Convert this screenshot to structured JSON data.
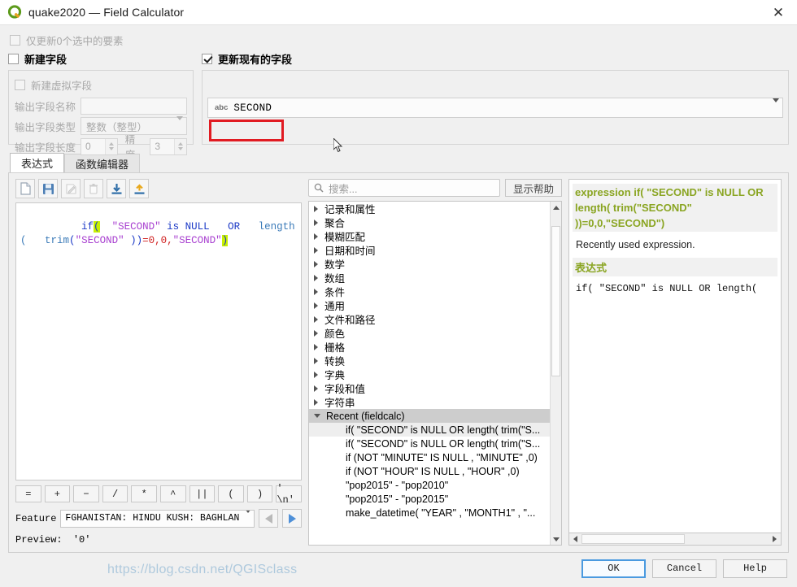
{
  "window": {
    "title": "quake2020 — Field Calculator",
    "logo_icon": "qgis-q-logo-icon",
    "close_icon": "✕"
  },
  "options": {
    "only_selected_label": "仅更新0个选中的要素",
    "create_new_field_label": "新建字段",
    "update_existing_field_label": "更新现有的字段"
  },
  "new_field": {
    "virtual_field_label": "新建虚拟字段",
    "name_label": "输出字段名称",
    "name_value": "",
    "type_label": "输出字段类型",
    "type_value": "整数（整型）",
    "length_label": "输出字段长度",
    "length_value": "0",
    "precision_label": "精度",
    "precision_value": "3"
  },
  "existing_field": {
    "type_tag": "abc",
    "selected_field": "SECOND"
  },
  "tabs": [
    {
      "label": "表达式",
      "active": true
    },
    {
      "label": "函数编辑器",
      "active": false
    }
  ],
  "expr_toolbar": [
    {
      "icon": "new-file-icon",
      "enabled": true
    },
    {
      "icon": "save-icon",
      "enabled": true
    },
    {
      "icon": "edit-pencil-icon",
      "enabled": false
    },
    {
      "icon": "delete-trash-icon",
      "enabled": false
    },
    {
      "icon": "import-download-icon",
      "enabled": true
    },
    {
      "icon": "export-upload-icon",
      "enabled": true
    }
  ],
  "expression": {
    "text": "if( \"SECOND\" is NULL  OR  length(  trim(\"SECOND\" ))=0,0,\"SECOND\")",
    "tokens": [
      {
        "t": "if",
        "c": "kw"
      },
      {
        "t": "(",
        "c": "hl"
      },
      {
        "t": "  ",
        "c": "plain"
      },
      {
        "t": "\"SECOND\"",
        "c": "str"
      },
      {
        "t": " is ",
        "c": "kw"
      },
      {
        "t": "NULL",
        "c": "kw"
      },
      {
        "t": "   ",
        "c": "plain"
      },
      {
        "t": "OR",
        "c": "kw"
      },
      {
        "t": "   ",
        "c": "plain"
      },
      {
        "t": "length(",
        "c": "fn"
      },
      {
        "t": "   ",
        "c": "plain"
      },
      {
        "t": "trim",
        "c": "fn"
      },
      {
        "t": "(",
        "c": "kw"
      },
      {
        "t": "\"SECOND\"",
        "c": "str"
      },
      {
        "t": " ))",
        "c": "kw"
      },
      {
        "t": "=",
        "c": "num"
      },
      {
        "t": "0",
        "c": "num"
      },
      {
        "t": ",",
        "c": "num"
      },
      {
        "t": "0",
        "c": "num"
      },
      {
        "t": ",",
        "c": "num"
      },
      {
        "t": "\"SECOND\"",
        "c": "str"
      },
      {
        "t": ")",
        "c": "hl"
      }
    ]
  },
  "operators": [
    "=",
    "+",
    "−",
    "/",
    "*",
    "^",
    "||",
    "(",
    ")",
    "' \\n'"
  ],
  "feature": {
    "label": "Feature",
    "value": "FGHANISTAN:   HINDU KUSH:    BAGHLAN",
    "prev_icon": "prev-feature-icon",
    "next_icon": "next-feature-icon"
  },
  "preview": {
    "label": "Preview:",
    "value": "'0'"
  },
  "search": {
    "placeholder": "搜索...",
    "icon": "search-icon",
    "help_button": "显示帮助"
  },
  "function_tree": {
    "categories": [
      "记录和属性",
      "聚合",
      "模糊匹配",
      "日期和时间",
      "数学",
      "数组",
      "条件",
      "通用",
      "文件和路径",
      "颜色",
      "栅格",
      "转换",
      "字典",
      "字段和值",
      "字符串"
    ],
    "recent_group": "Recent (fieldcalc)",
    "recent_items": [
      "if( \"SECOND\" is NULL  OR  length(  trim(\"S...",
      "if( \"SECOND\" is NULL  OR  length(  trim(\"S...",
      "if (NOT  \"MINUTE\" IS NULL , \"MINUTE\" ,0)",
      "if (NOT  \"HOUR\" IS NULL , \"HOUR\" ,0)",
      " \"pop2015\"  -  \"pop2010\"",
      " \"pop2015\"  -  \"pop2015\"",
      "make_datetime(  \"YEAR\"  , \"MONTH1\" , \"..."
    ],
    "selected_index": 0
  },
  "help_panel": {
    "heading": "expression if( \"SECOND\" is NULL OR length( trim(\"SECOND\" ))=0,0,\"SECOND\")",
    "description": "Recently used expression.",
    "subheading": "表达式",
    "code": "if( \"SECOND\" is NULL  OR  length("
  },
  "footer": {
    "ok_label": "OK",
    "cancel_label": "Cancel",
    "help_label": "Help",
    "watermark": "https://blog.csdn.net/QGISclass"
  },
  "colors": {
    "accent_blue": "#4a9ae0",
    "annotation_red": "#e11b22",
    "help_olive": "#8aa522",
    "string_purple": "#a83fd0",
    "keyword_blue": "#1b39c6",
    "highlight_yellow": "#c8f000"
  }
}
